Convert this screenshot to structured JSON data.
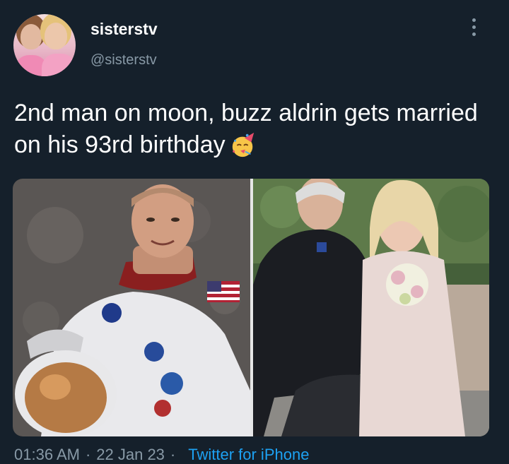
{
  "tweet": {
    "display_name": "sisterstv",
    "handle": "@sisterstv",
    "text": "2nd man on moon, buzz aldrin gets married on his 93rd birthday",
    "emoji": "partying-face",
    "time": "01:36 AM",
    "date": "22 Jan 23",
    "source": "Twitter for iPhone"
  },
  "icons": {
    "more": "vertical-ellipsis-icon"
  },
  "colors": {
    "background": "#15202b",
    "secondary_text": "#8899a6",
    "link": "#1da1f2"
  }
}
